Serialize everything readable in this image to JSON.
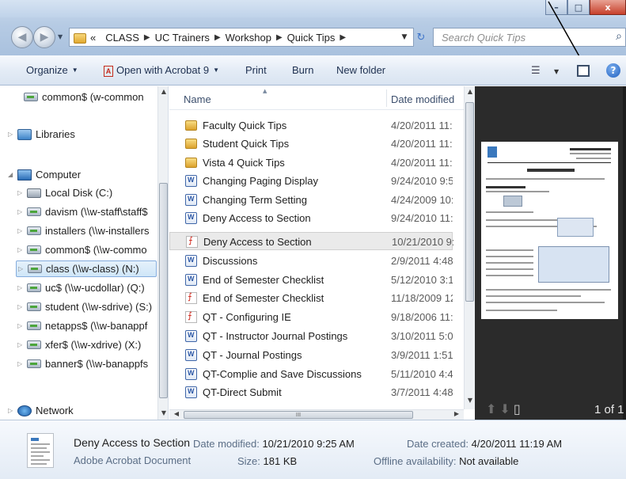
{
  "window": {
    "minimize": "–",
    "maximize": "□",
    "close": "x"
  },
  "nav": {
    "back": "◀",
    "forward": "▶",
    "recent": "▼"
  },
  "address": {
    "overflow": "«",
    "crumbs": [
      "CLASS",
      "UC Trainers",
      "Workshop",
      "Quick Tips"
    ],
    "separator": "▶",
    "dropdown": "▼",
    "refresh": "↻"
  },
  "search": {
    "placeholder": "Search Quick Tips",
    "icon": "magnifier"
  },
  "toolbar": {
    "organize": "Organize",
    "open_with": "Open with Acrobat 9",
    "print": "Print",
    "burn": "Burn",
    "new_folder": "New folder",
    "dropdown": "▼",
    "help": "?"
  },
  "navpane": {
    "items": [
      {
        "label": "common$ (w-common",
        "icon": "network-drive"
      },
      {
        "label": "Libraries",
        "icon": "libraries"
      },
      {
        "label": "Computer",
        "icon": "computer"
      },
      {
        "label": "Local Disk (C:)",
        "icon": "local-disk"
      },
      {
        "label": "davism (\\\\w-staff\\staff$",
        "icon": "network-drive"
      },
      {
        "label": "installers (\\\\w-installers",
        "icon": "network-drive"
      },
      {
        "label": "common$ (\\\\w-commo",
        "icon": "network-drive"
      },
      {
        "label": "class (\\\\w-class) (N:)",
        "icon": "network-drive",
        "selected": true
      },
      {
        "label": "uc$ (\\\\w-ucdollar) (Q:)",
        "icon": "network-drive"
      },
      {
        "label": "student (\\\\w-sdrive) (S:)",
        "icon": "network-drive"
      },
      {
        "label": "netapps$ (\\\\w-banappf",
        "icon": "network-drive"
      },
      {
        "label": "xfer$ (\\\\w-xdrive) (X:)",
        "icon": "network-drive"
      },
      {
        "label": "banner$ (\\\\w-banappfs",
        "icon": "network-drive"
      },
      {
        "label": "Network",
        "icon": "network"
      }
    ]
  },
  "filelist": {
    "col_name": "Name",
    "col_date": "Date modified",
    "scroll_grip": "III",
    "rows": [
      {
        "name": "Faculty Quick Tips",
        "date": "4/20/2011 11:1",
        "type": "folder"
      },
      {
        "name": "Student Quick Tips",
        "date": "4/20/2011 11:1",
        "type": "folder"
      },
      {
        "name": "Vista 4 Quick Tips",
        "date": "4/20/2011 11:1",
        "type": "folder"
      },
      {
        "name": "Changing Paging Display",
        "date": "9/24/2010 9:56",
        "type": "word"
      },
      {
        "name": "Changing Term Setting",
        "date": "4/24/2009 10:5",
        "type": "word"
      },
      {
        "name": "Deny Access to Section",
        "date": "9/24/2010 11:0",
        "type": "word"
      },
      {
        "name": "Deny Access to Section",
        "date": "10/21/2010 9:2",
        "type": "pdf",
        "selected": true
      },
      {
        "name": "Discussions",
        "date": "2/9/2011 4:48 I",
        "type": "word"
      },
      {
        "name": "End of Semester Checklist",
        "date": "5/12/2010 3:15",
        "type": "word"
      },
      {
        "name": "End of Semester Checklist",
        "date": "11/18/2009 12:",
        "type": "pdf"
      },
      {
        "name": "QT - Configuring IE",
        "date": "9/18/2006 11:4",
        "type": "pdf"
      },
      {
        "name": "QT - Instructor Journal Postings",
        "date": "3/10/2011 5:06",
        "type": "word"
      },
      {
        "name": "QT - Journal Postings",
        "date": "3/9/2011 1:51 I",
        "type": "word"
      },
      {
        "name": "QT-Complie and Save Discussions",
        "date": "5/11/2010 4:44",
        "type": "word"
      },
      {
        "name": "QT-Direct Submit",
        "date": "3/7/2011 4:48 I",
        "type": "word"
      }
    ]
  },
  "preview": {
    "doc_title": "Deny/Allow Access",
    "page_indicator": "1 of 1"
  },
  "details": {
    "name": "Deny Access to Section",
    "type": "Adobe Acrobat Document",
    "date_modified_label": "Date modified:",
    "date_modified": "10/21/2010 9:25 AM",
    "size_label": "Size:",
    "size": "181 KB",
    "date_created_label": "Date created:",
    "date_created": "4/20/2011 11:19 AM",
    "offline_label": "Offline availability:",
    "offline": "Not available"
  }
}
